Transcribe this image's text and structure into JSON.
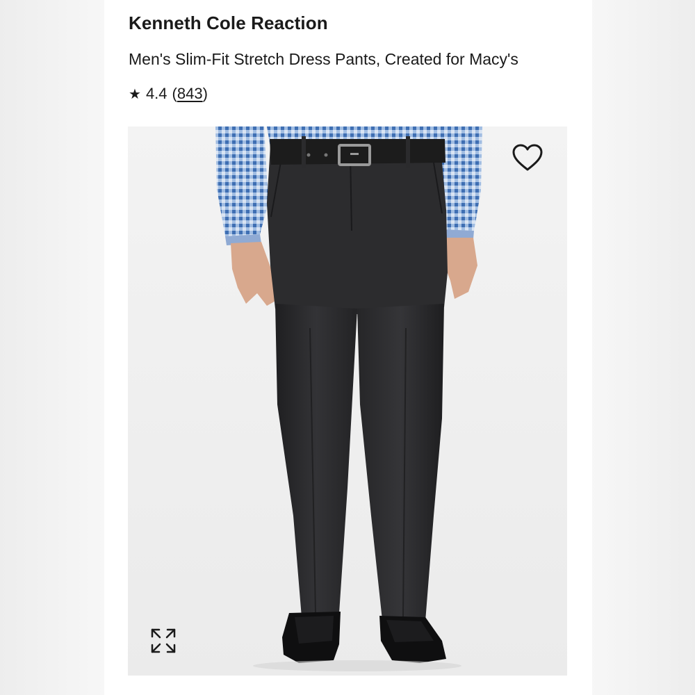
{
  "product": {
    "brand": "Kenneth Cole Reaction",
    "name": "Men's Slim-Fit Stretch Dress Pants, Created for Macy's",
    "rating": {
      "star": "★",
      "value": "4.4",
      "open_paren": "(",
      "count": "843",
      "close_paren": ")"
    }
  },
  "image": {
    "alt": "Model wearing dark charcoal slim-fit dress pants with a black belt, blue gingham shirt and black loafers",
    "icons": {
      "favorite": "heart-outline-icon",
      "expand": "expand-arrows-icon"
    }
  },
  "colors": {
    "pants": "#2b2b2d",
    "shirt_blue": "#5b86c4",
    "belt": "#1c1c1c",
    "background": "#f1f1f1"
  }
}
